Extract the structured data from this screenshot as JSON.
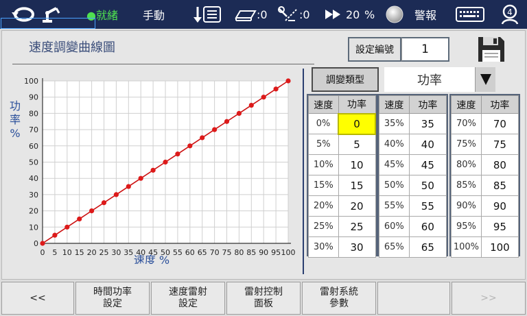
{
  "topbar": {
    "status": "●就緒",
    "mode": "手動",
    "counter1": ":0",
    "counter2": ":0",
    "speed_value": "20",
    "speed_unit": "%",
    "alarm_label": "警報"
  },
  "page": {
    "title": "速度調變曲線圖",
    "set_number_label": "設定編號",
    "set_number_value": "1",
    "mod_type_label": "調變類型",
    "mod_type_value": "功率"
  },
  "table": {
    "speed_header": "速度",
    "power_header": "功率",
    "columns": [
      {
        "speeds": [
          "0%",
          "5%",
          "10%",
          "15%",
          "20%",
          "25%",
          "30%"
        ],
        "powers": [
          "0",
          "5",
          "10",
          "15",
          "20",
          "25",
          "30"
        ]
      },
      {
        "speeds": [
          "35%",
          "40%",
          "45%",
          "50%",
          "55%",
          "60%",
          "65%"
        ],
        "powers": [
          "35",
          "40",
          "45",
          "50",
          "55",
          "60",
          "65"
        ]
      },
      {
        "speeds": [
          "70%",
          "75%",
          "80%",
          "85%",
          "90%",
          "95%",
          "100%"
        ],
        "powers": [
          "70",
          "75",
          "80",
          "85",
          "90",
          "95",
          "100"
        ]
      }
    ]
  },
  "chart_data": {
    "type": "line",
    "x": [
      0,
      5,
      10,
      15,
      20,
      25,
      30,
      35,
      40,
      45,
      50,
      55,
      60,
      65,
      70,
      75,
      80,
      85,
      90,
      95,
      100
    ],
    "series": [
      {
        "values": [
          0,
          5,
          10,
          15,
          20,
          25,
          30,
          35,
          40,
          45,
          50,
          55,
          60,
          65,
          70,
          75,
          80,
          85,
          90,
          95,
          100
        ]
      }
    ],
    "xlabel": "速度 %",
    "ylabel": "功率 %",
    "xlim": [
      0,
      100
    ],
    "ylim": [
      0,
      100
    ],
    "xticks": [
      "0",
      "5",
      "10",
      "15",
      "20",
      "25",
      "30",
      "35",
      "40",
      "45",
      "50",
      "55",
      "60",
      "65",
      "70",
      "75",
      "80",
      "85",
      "90",
      "95",
      "100"
    ],
    "yticks": [
      "0",
      "10",
      "20",
      "30",
      "40",
      "50",
      "60",
      "70",
      "80",
      "90",
      "100"
    ],
    "grid": true,
    "line_color": "#cc1111"
  },
  "bottom": {
    "prev": "<<",
    "btn1_line1": "時間功率",
    "btn1_line2": "設定",
    "btn2_line1": "速度雷射",
    "btn2_line2": "設定",
    "btn3_line1": "雷射控制",
    "btn3_line2": "面板",
    "btn4_line1": "雷射系統",
    "btn4_line2": "參數",
    "next": ">>"
  }
}
